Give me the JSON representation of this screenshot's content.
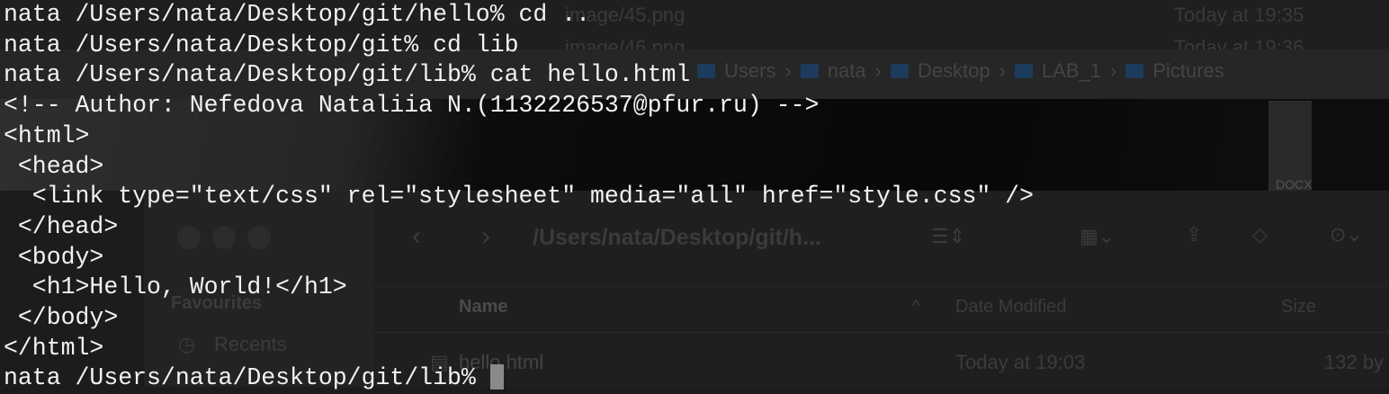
{
  "finder": {
    "rows_top": [
      {
        "name": "image/45.png",
        "date": "Today at 19:35"
      },
      {
        "name": "image/46.png",
        "date": "Today at 19:36"
      }
    ],
    "breadcrumb": [
      "Users",
      "nata",
      "Desktop",
      "LAB_1",
      "Pictures"
    ],
    "preview_label": "DOCX",
    "path_title": "/Users/nata/Desktop/git/h...",
    "sidebar": {
      "section": "Favourites",
      "items": [
        "Recents"
      ]
    },
    "columns": {
      "name": "Name",
      "date": "Date Modified",
      "size": "Size"
    },
    "files": [
      {
        "name": "hello.html",
        "date": "Today at 19:03",
        "size": "132 by"
      }
    ]
  },
  "terminal": {
    "lines": [
      "nata /Users/nata/Desktop/git/hello% cd ..",
      "nata /Users/nata/Desktop/git% cd lib",
      "nata /Users/nata/Desktop/git/lib% cat hello.html",
      "<!-- Author: Nefedova Nataliia N.(1132226537@pfur.ru) -->",
      "<html>",
      " <head>",
      "  <link type=\"text/css\" rel=\"stylesheet\" media=\"all\" href=\"style.css\" />",
      " </head>",
      " <body>",
      "  <h1>Hello, World!</h1>",
      " </body>",
      "</html>"
    ],
    "prompt": "nata /Users/nata/Desktop/git/lib% "
  }
}
